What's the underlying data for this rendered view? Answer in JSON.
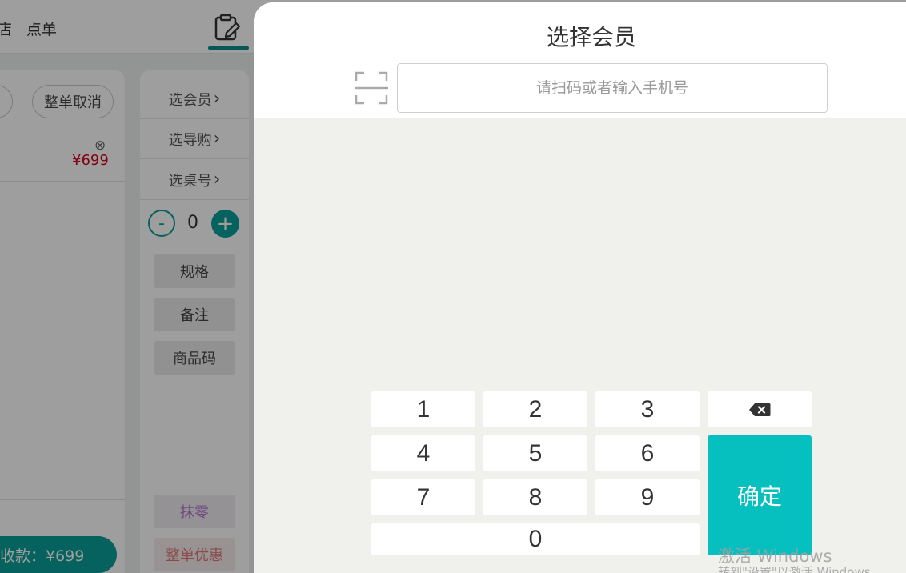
{
  "header": {
    "store_fragment": "店",
    "order_tab": "点单",
    "order_icon": "edit-note-icon"
  },
  "cart": {
    "cancel_partial_label": "",
    "cancel_all_label": "整单取消",
    "remove_icon": "⊗",
    "item_price": "¥699",
    "checkout_label": "收款：¥699"
  },
  "side": {
    "select_member": "选会员",
    "select_guide": "选导购",
    "select_table": "选桌号",
    "chevron": "›",
    "qty_minus": "-",
    "qty_value": "0",
    "qty_plus": "+",
    "spec": "规格",
    "remark": "备注",
    "product_code": "商品码",
    "round_off": "抹零",
    "order_discount": "整单优惠"
  },
  "drawer": {
    "title": "选择会员",
    "scan_icon": "scan-icon",
    "search_placeholder": "请扫码或者输入手机号",
    "search_value": "",
    "keys": {
      "k1": "1",
      "k2": "2",
      "k3": "3",
      "k4": "4",
      "k5": "5",
      "k6": "6",
      "k7": "7",
      "k8": "8",
      "k9": "9",
      "k0": "0"
    },
    "backspace_icon": "backspace-icon",
    "confirm_label": "确定"
  },
  "watermark": {
    "line1": "激活 Windows",
    "line2": "转到\"设置\"以激活 Windows。"
  },
  "colors": {
    "accent": "#0a9e98",
    "confirm": "#06bfbf",
    "price": "#d0021b"
  }
}
